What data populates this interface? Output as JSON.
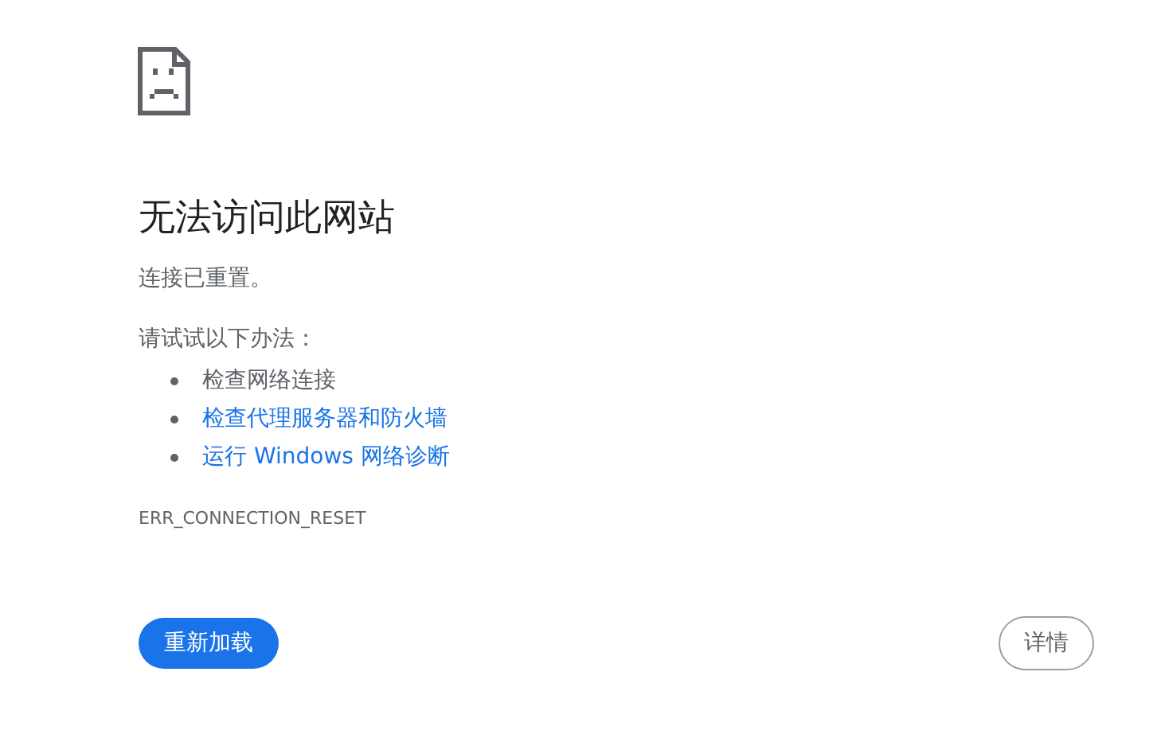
{
  "heading": "无法访问此网站",
  "summary": "连接已重置。",
  "suggestions": {
    "title": "请试试以下办法：",
    "items": [
      {
        "kind": "text",
        "label": "检查网络连接"
      },
      {
        "kind": "link",
        "label": "检查代理服务器和防火墙"
      },
      {
        "kind": "link",
        "label": "运行 Windows 网络诊断"
      }
    ]
  },
  "error_code": "ERR_CONNECTION_RESET",
  "buttons": {
    "reload": "重新加载",
    "details": "详情"
  }
}
